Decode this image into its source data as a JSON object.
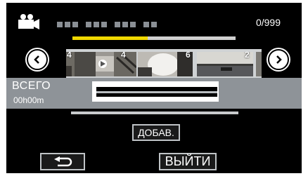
{
  "header": {
    "mode_icon": "video-camera-icon",
    "title_redacted": true,
    "counter": "0/999"
  },
  "playlist": {
    "progress": 0.46,
    "progress_color": "#f0d800",
    "thumbnails": [
      {
        "number": "4"
      },
      {
        "number": "4"
      },
      {
        "number": "6"
      },
      {
        "number": "2"
      }
    ]
  },
  "nav": {
    "prev_icon": "chevron-left-icon",
    "next_icon": "chevron-right-icon"
  },
  "summary": {
    "total_label": "ВСЕГО",
    "total_time": "00h00m"
  },
  "buttons": {
    "add_label": "ДОБАВ.",
    "back_icon": "return-arrow-icon",
    "exit_label": "ВЫЙТИ"
  }
}
